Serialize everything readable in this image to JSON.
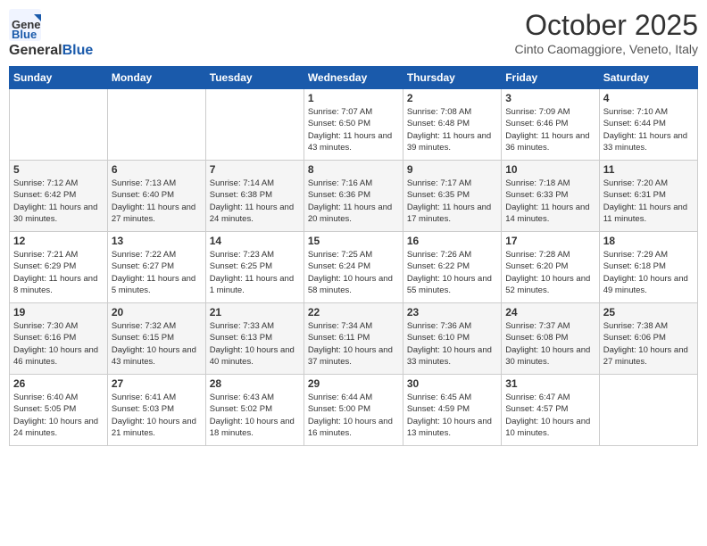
{
  "logo": {
    "general": "General",
    "blue": "Blue"
  },
  "title": "October 2025",
  "subtitle": "Cinto Caomaggiore, Veneto, Italy",
  "days_of_week": [
    "Sunday",
    "Monday",
    "Tuesday",
    "Wednesday",
    "Thursday",
    "Friday",
    "Saturday"
  ],
  "weeks": [
    [
      {
        "day": "",
        "info": ""
      },
      {
        "day": "",
        "info": ""
      },
      {
        "day": "",
        "info": ""
      },
      {
        "day": "1",
        "info": "Sunrise: 7:07 AM\nSunset: 6:50 PM\nDaylight: 11 hours and 43 minutes."
      },
      {
        "day": "2",
        "info": "Sunrise: 7:08 AM\nSunset: 6:48 PM\nDaylight: 11 hours and 39 minutes."
      },
      {
        "day": "3",
        "info": "Sunrise: 7:09 AM\nSunset: 6:46 PM\nDaylight: 11 hours and 36 minutes."
      },
      {
        "day": "4",
        "info": "Sunrise: 7:10 AM\nSunset: 6:44 PM\nDaylight: 11 hours and 33 minutes."
      }
    ],
    [
      {
        "day": "5",
        "info": "Sunrise: 7:12 AM\nSunset: 6:42 PM\nDaylight: 11 hours and 30 minutes."
      },
      {
        "day": "6",
        "info": "Sunrise: 7:13 AM\nSunset: 6:40 PM\nDaylight: 11 hours and 27 minutes."
      },
      {
        "day": "7",
        "info": "Sunrise: 7:14 AM\nSunset: 6:38 PM\nDaylight: 11 hours and 24 minutes."
      },
      {
        "day": "8",
        "info": "Sunrise: 7:16 AM\nSunset: 6:36 PM\nDaylight: 11 hours and 20 minutes."
      },
      {
        "day": "9",
        "info": "Sunrise: 7:17 AM\nSunset: 6:35 PM\nDaylight: 11 hours and 17 minutes."
      },
      {
        "day": "10",
        "info": "Sunrise: 7:18 AM\nSunset: 6:33 PM\nDaylight: 11 hours and 14 minutes."
      },
      {
        "day": "11",
        "info": "Sunrise: 7:20 AM\nSunset: 6:31 PM\nDaylight: 11 hours and 11 minutes."
      }
    ],
    [
      {
        "day": "12",
        "info": "Sunrise: 7:21 AM\nSunset: 6:29 PM\nDaylight: 11 hours and 8 minutes."
      },
      {
        "day": "13",
        "info": "Sunrise: 7:22 AM\nSunset: 6:27 PM\nDaylight: 11 hours and 5 minutes."
      },
      {
        "day": "14",
        "info": "Sunrise: 7:23 AM\nSunset: 6:25 PM\nDaylight: 11 hours and 1 minute."
      },
      {
        "day": "15",
        "info": "Sunrise: 7:25 AM\nSunset: 6:24 PM\nDaylight: 10 hours and 58 minutes."
      },
      {
        "day": "16",
        "info": "Sunrise: 7:26 AM\nSunset: 6:22 PM\nDaylight: 10 hours and 55 minutes."
      },
      {
        "day": "17",
        "info": "Sunrise: 7:28 AM\nSunset: 6:20 PM\nDaylight: 10 hours and 52 minutes."
      },
      {
        "day": "18",
        "info": "Sunrise: 7:29 AM\nSunset: 6:18 PM\nDaylight: 10 hours and 49 minutes."
      }
    ],
    [
      {
        "day": "19",
        "info": "Sunrise: 7:30 AM\nSunset: 6:16 PM\nDaylight: 10 hours and 46 minutes."
      },
      {
        "day": "20",
        "info": "Sunrise: 7:32 AM\nSunset: 6:15 PM\nDaylight: 10 hours and 43 minutes."
      },
      {
        "day": "21",
        "info": "Sunrise: 7:33 AM\nSunset: 6:13 PM\nDaylight: 10 hours and 40 minutes."
      },
      {
        "day": "22",
        "info": "Sunrise: 7:34 AM\nSunset: 6:11 PM\nDaylight: 10 hours and 37 minutes."
      },
      {
        "day": "23",
        "info": "Sunrise: 7:36 AM\nSunset: 6:10 PM\nDaylight: 10 hours and 33 minutes."
      },
      {
        "day": "24",
        "info": "Sunrise: 7:37 AM\nSunset: 6:08 PM\nDaylight: 10 hours and 30 minutes."
      },
      {
        "day": "25",
        "info": "Sunrise: 7:38 AM\nSunset: 6:06 PM\nDaylight: 10 hours and 27 minutes."
      }
    ],
    [
      {
        "day": "26",
        "info": "Sunrise: 6:40 AM\nSunset: 5:05 PM\nDaylight: 10 hours and 24 minutes."
      },
      {
        "day": "27",
        "info": "Sunrise: 6:41 AM\nSunset: 5:03 PM\nDaylight: 10 hours and 21 minutes."
      },
      {
        "day": "28",
        "info": "Sunrise: 6:43 AM\nSunset: 5:02 PM\nDaylight: 10 hours and 18 minutes."
      },
      {
        "day": "29",
        "info": "Sunrise: 6:44 AM\nSunset: 5:00 PM\nDaylight: 10 hours and 16 minutes."
      },
      {
        "day": "30",
        "info": "Sunrise: 6:45 AM\nSunset: 4:59 PM\nDaylight: 10 hours and 13 minutes."
      },
      {
        "day": "31",
        "info": "Sunrise: 6:47 AM\nSunset: 4:57 PM\nDaylight: 10 hours and 10 minutes."
      },
      {
        "day": "",
        "info": ""
      }
    ]
  ]
}
